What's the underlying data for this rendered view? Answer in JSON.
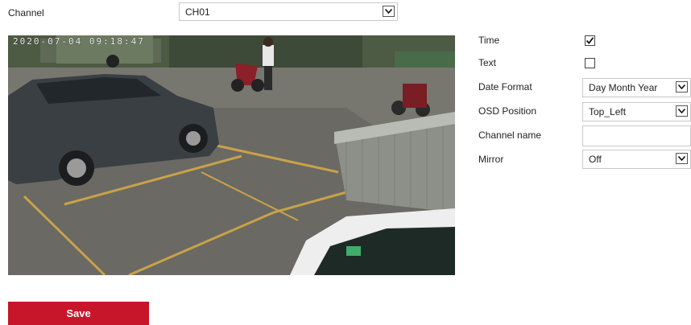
{
  "channel": {
    "label": "Channel",
    "value": "CH01"
  },
  "preview": {
    "osd_timestamp": "2020-07-04  09:18:47"
  },
  "settings": {
    "time": {
      "label": "Time",
      "checked": true
    },
    "text": {
      "label": "Text",
      "checked": false
    },
    "date_format": {
      "label": "Date Format",
      "value": "Day Month Year"
    },
    "osd_position": {
      "label": "OSD Position",
      "value": "Top_Left"
    },
    "channel_name": {
      "label": "Channel name",
      "value": ""
    },
    "mirror": {
      "label": "Mirror",
      "value": "Off"
    }
  },
  "actions": {
    "save_label": "Save"
  },
  "colors": {
    "accent": "#c7152a"
  }
}
